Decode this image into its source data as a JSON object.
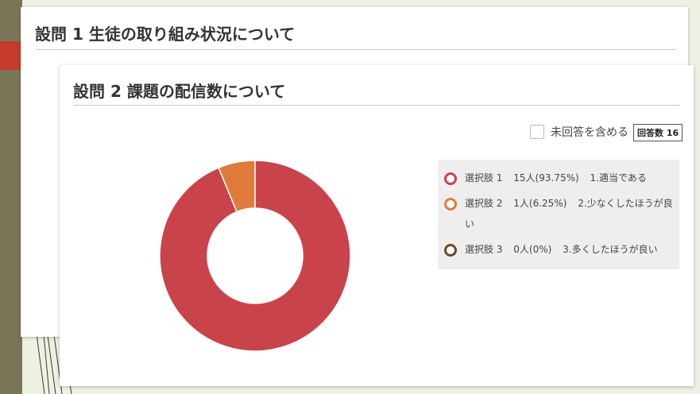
{
  "back_card": {
    "title": "設問 1 生徒の取り組み状況について"
  },
  "front_card": {
    "title": "設問 2 課題の配信数について",
    "include_unanswered_label": "未回答を含める",
    "response_count_label": "回答数 16"
  },
  "chart_data": {
    "type": "pie",
    "donut": true,
    "categories": [
      "選択肢 1",
      "選択肢 2",
      "選択肢 3"
    ],
    "values": [
      15,
      1,
      0
    ],
    "percent": [
      "93.75%",
      "6.25%",
      "0%"
    ],
    "labels": [
      "1.適当である",
      "2.少なくしたほうが良い",
      "3.多くしたほうが良い"
    ],
    "colors": [
      "#c9434b",
      "#e07b3c",
      "#6b4a2f"
    ],
    "legend_placement": "right"
  },
  "legend": [
    {
      "choice": "選択肢 1",
      "count": "15人(93.75%)",
      "label": "1.適当である",
      "color": "#c9434b"
    },
    {
      "choice": "選択肢 2",
      "count": "1人(6.25%)",
      "label": "2.少なくしたほうが良い",
      "color": "#e07b3c"
    },
    {
      "choice": "選択肢 3",
      "count": "0人(0%)",
      "label": "3.多くしたほうが良い",
      "color": "#6b4a2f"
    }
  ]
}
